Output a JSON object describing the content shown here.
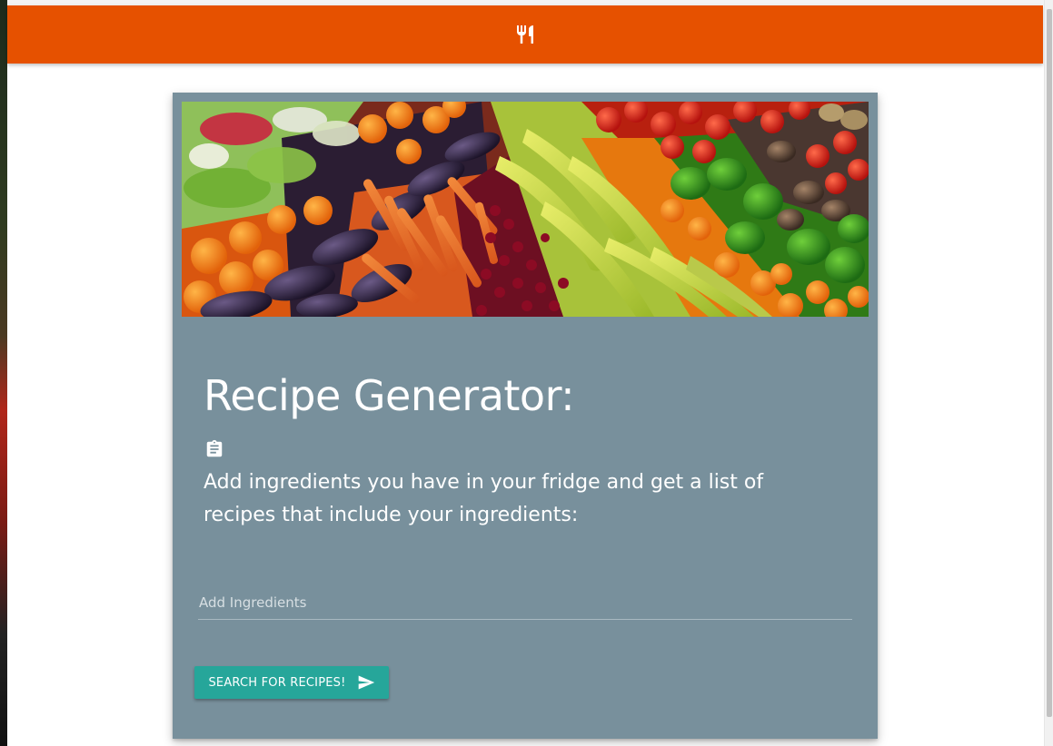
{
  "navbar": {
    "logo_icon": "fork-and-knife-icon",
    "color": "#e65100"
  },
  "card": {
    "background_color": "#78909c",
    "image_icon": "vegetables-and-fruits-image",
    "title": "Recipe Generator:",
    "title_icon": "clipboard-icon",
    "description": "Add ingredients you have in your fridge and get a list of recipes that include your ingredients:",
    "ingredient_input": {
      "placeholder": "Add Ingredients",
      "value": ""
    },
    "search_button": {
      "label": "Search for recipes!",
      "icon": "send-icon",
      "color": "#26a69a"
    }
  }
}
